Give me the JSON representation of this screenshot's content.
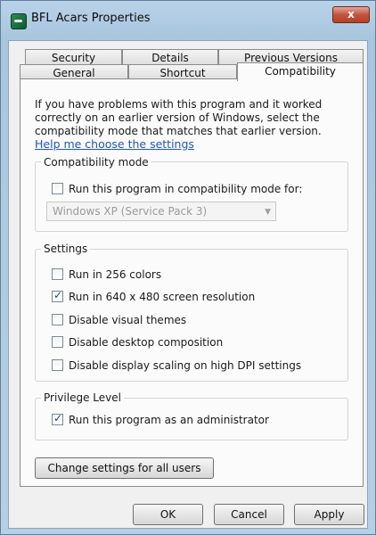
{
  "window": {
    "title": "BFL Acars Properties",
    "close_glyph": "x"
  },
  "tabs": {
    "row1": [
      "Security",
      "Details",
      "Previous Versions"
    ],
    "row2": [
      "General",
      "Shortcut",
      "Compatibility"
    ],
    "active": "Compatibility"
  },
  "intro": "If you have problems with this program and it worked correctly on an earlier version of Windows, select the compatibility mode that matches that earlier version.",
  "help_link": "Help me choose the settings",
  "compat_mode": {
    "title": "Compatibility mode",
    "checkbox_label": "Run this program in compatibility mode for:",
    "checked": false,
    "selected_os": "Windows XP (Service Pack 3)"
  },
  "settings": {
    "title": "Settings",
    "options": [
      {
        "label": "Run in 256 colors",
        "checked": false
      },
      {
        "label": "Run in 640 x 480 screen resolution",
        "checked": true
      },
      {
        "label": "Disable visual themes",
        "checked": false
      },
      {
        "label": "Disable desktop composition",
        "checked": false
      },
      {
        "label": "Disable display scaling on high DPI settings",
        "checked": false
      }
    ]
  },
  "privilege": {
    "title": "Privilege Level",
    "checkbox_label": "Run this program as an administrator",
    "checked": true
  },
  "buttons": {
    "change_all": "Change settings for all users",
    "ok": "OK",
    "cancel": "Cancel",
    "apply": "Apply"
  },
  "icons": {
    "app": "app-icon",
    "dropdown": "chevron-down-icon",
    "close": "close-icon"
  }
}
